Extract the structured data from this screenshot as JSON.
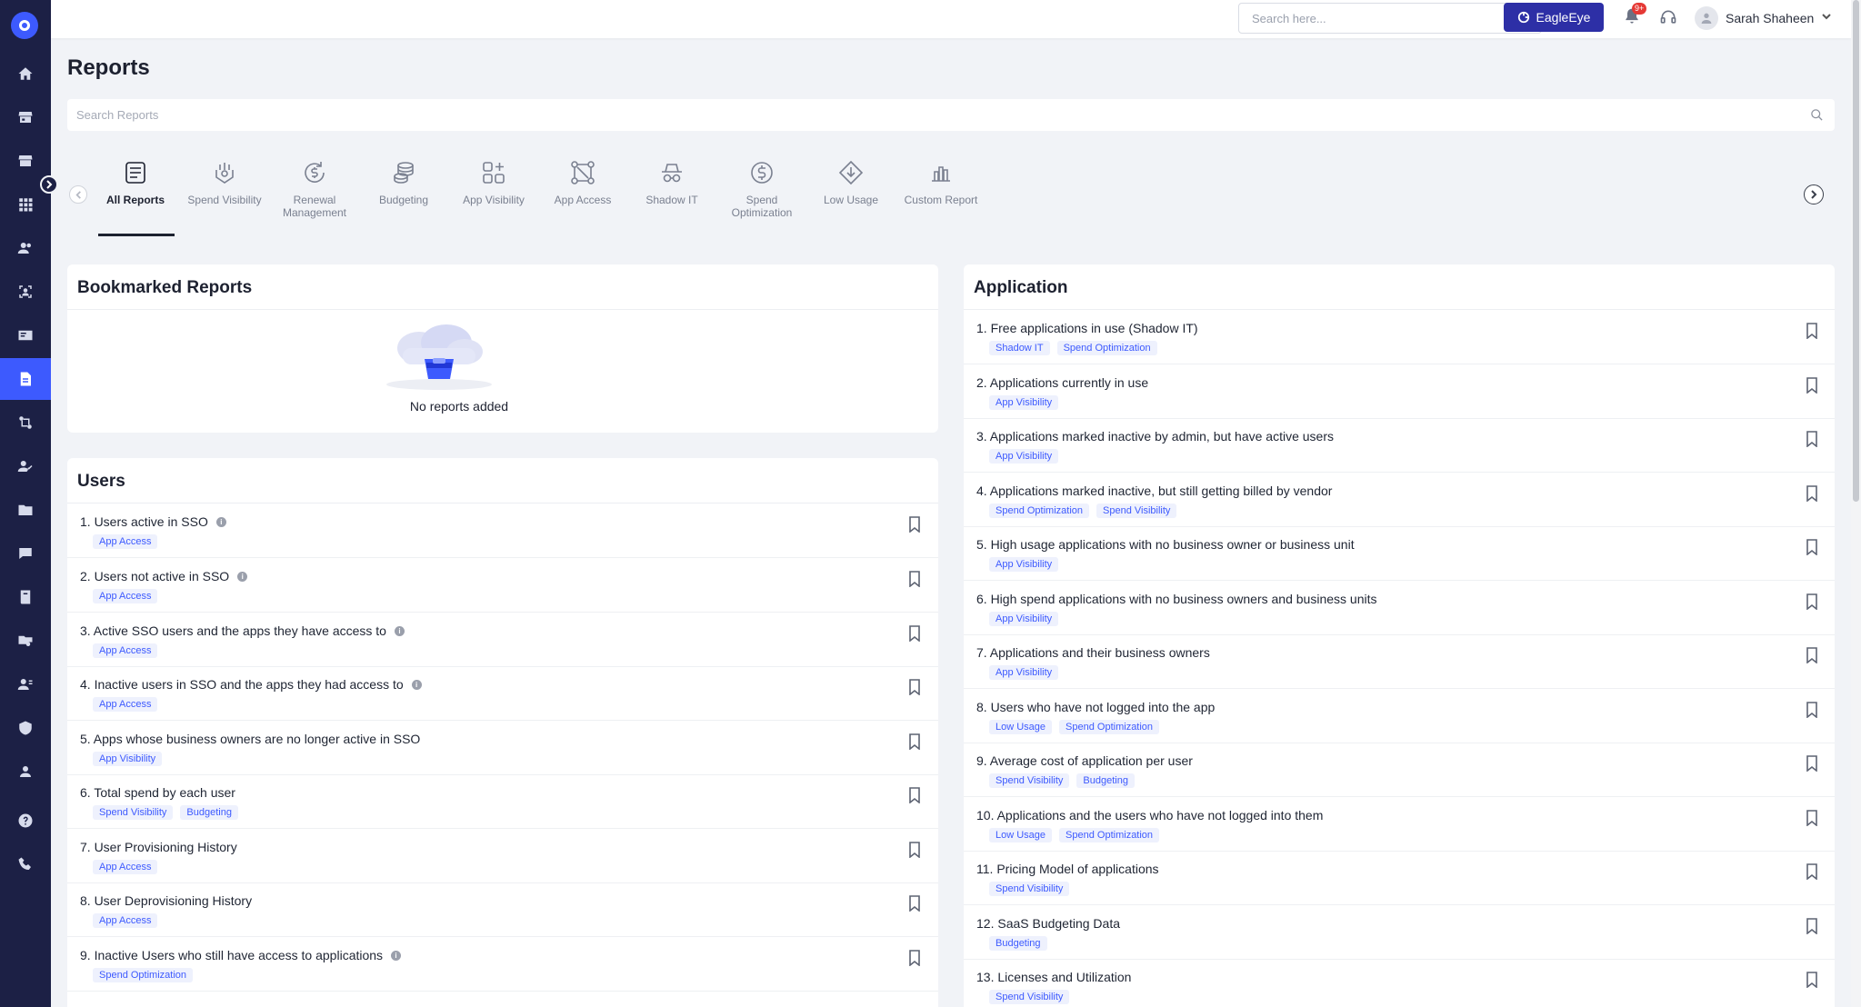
{
  "topbar": {
    "search_placeholder": "Search here...",
    "eagle_label": "EagleEye",
    "notification_count": "9+",
    "user_name": "Sarah Shaheen"
  },
  "page": {
    "title": "Reports",
    "search_placeholder": "Search Reports"
  },
  "categories": [
    {
      "label": "All Reports",
      "icon": "all-reports-icon",
      "active": true
    },
    {
      "label": "Spend Visibility",
      "icon": "spend-visibility-icon"
    },
    {
      "label": "Renewal Management",
      "icon": "renewal-management-icon"
    },
    {
      "label": "Budgeting",
      "icon": "budgeting-icon"
    },
    {
      "label": "App Visibility",
      "icon": "app-visibility-icon"
    },
    {
      "label": "App Access",
      "icon": "app-access-icon"
    },
    {
      "label": "Shadow IT",
      "icon": "shadow-it-icon"
    },
    {
      "label": "Spend Optimization",
      "icon": "spend-optimization-icon"
    },
    {
      "label": "Low Usage",
      "icon": "low-usage-icon"
    },
    {
      "label": "Custom Report",
      "icon": "custom-report-icon"
    }
  ],
  "bookmarked": {
    "title": "Bookmarked Reports",
    "empty_text": "No reports added"
  },
  "users": {
    "title": "Users",
    "items": [
      {
        "title": "1. Users active in SSO",
        "info": true,
        "tags": [
          "App Access"
        ]
      },
      {
        "title": "2. Users not active in SSO",
        "info": true,
        "tags": [
          "App Access"
        ]
      },
      {
        "title": "3. Active SSO users and the apps they have access to",
        "info": true,
        "tags": [
          "App Access"
        ]
      },
      {
        "title": "4. Inactive users in SSO and the apps they had access to",
        "info": true,
        "tags": [
          "App Access"
        ]
      },
      {
        "title": "5. Apps whose business owners are no longer active in SSO",
        "info": false,
        "tags": [
          "App Visibility"
        ]
      },
      {
        "title": "6. Total spend by each user",
        "info": false,
        "tags": [
          "Spend Visibility",
          "Budgeting"
        ]
      },
      {
        "title": "7. User Provisioning History",
        "info": false,
        "tags": [
          "App Access"
        ]
      },
      {
        "title": "8. User Deprovisioning History",
        "info": false,
        "tags": [
          "App Access"
        ]
      },
      {
        "title": "9. Inactive Users who still have access to applications",
        "info": true,
        "tags": [
          "Spend Optimization"
        ]
      }
    ]
  },
  "application": {
    "title": "Application",
    "items": [
      {
        "title": "1. Free applications in use (Shadow IT)",
        "tags": [
          "Shadow IT",
          "Spend Optimization"
        ]
      },
      {
        "title": "2. Applications currently in use",
        "tags": [
          "App Visibility"
        ]
      },
      {
        "title": "3. Applications marked inactive by admin, but have active users",
        "tags": [
          "App Visibility"
        ]
      },
      {
        "title": "4. Applications marked inactive, but still getting billed by vendor",
        "tags": [
          "Spend Optimization",
          "Spend Visibility"
        ]
      },
      {
        "title": "5. High usage applications with no business owner or business unit",
        "tags": [
          "App Visibility"
        ]
      },
      {
        "title": "6. High spend applications with no business owners and business units",
        "tags": [
          "App Visibility"
        ]
      },
      {
        "title": "7. Applications and their business owners",
        "tags": [
          "App Visibility"
        ]
      },
      {
        "title": "8. Users who have not logged into the app",
        "tags": [
          "Low Usage",
          "Spend Optimization"
        ]
      },
      {
        "title": "9. Average cost of application per user",
        "tags": [
          "Spend Visibility",
          "Budgeting"
        ]
      },
      {
        "title": "10. Applications and the users who have not logged into them",
        "tags": [
          "Low Usage",
          "Spend Optimization"
        ]
      },
      {
        "title": "11. Pricing Model of applications",
        "tags": [
          "Spend Visibility"
        ]
      },
      {
        "title": "12. SaaS Budgeting Data",
        "tags": [
          "Budgeting"
        ]
      },
      {
        "title": "13. Licenses and Utilization",
        "tags": [
          "Spend Visibility"
        ]
      }
    ]
  },
  "colors": {
    "sidebar": "#1c2045",
    "accent": "#3d5afe",
    "eagle_button": "#2d2fa6",
    "tag_text": "#3d5afe",
    "tag_bg": "#eef1fd"
  }
}
